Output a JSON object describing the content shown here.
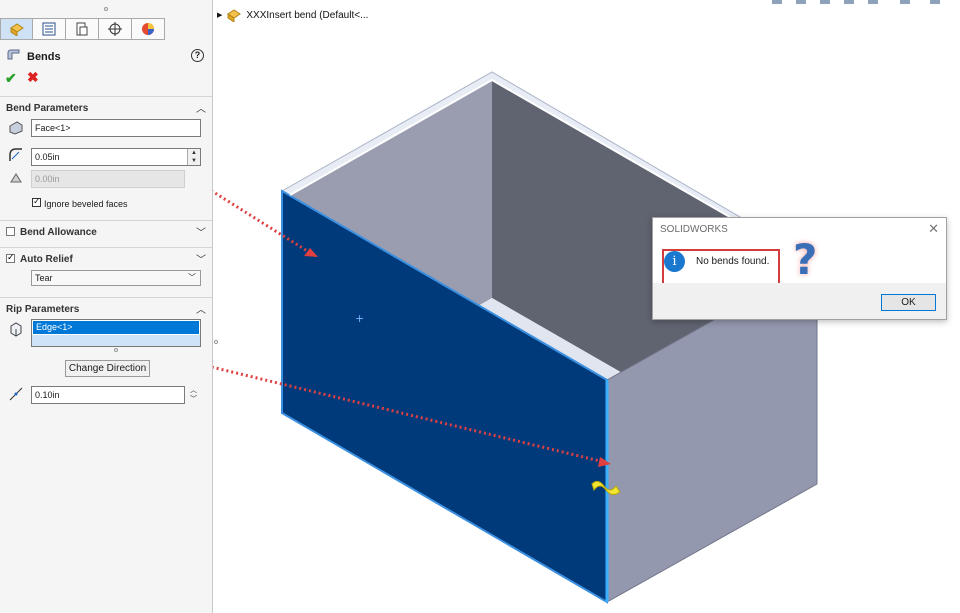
{
  "tree": {
    "item": "XXXInsert bend  (Default<..."
  },
  "panel": {
    "title": "Bends",
    "bend_parameters": {
      "label": "Bend Parameters",
      "fixed_face": "Face<1>",
      "bend_radius": "0.05in",
      "thickness": "0.00in",
      "ignore_beveled_label": "Ignore beveled faces"
    },
    "bend_allowance": {
      "label": "Bend Allowance"
    },
    "auto_relief": {
      "label": "Auto Relief",
      "type": "Tear"
    },
    "rip_parameters": {
      "label": "Rip Parameters",
      "edge": "Edge<1>",
      "change_direction": "Change Direction",
      "rip_gap": "0.10in"
    }
  },
  "dialog": {
    "title": "SOLIDWORKS",
    "message": "No bends found.",
    "ok": "OK"
  },
  "colors": {
    "selected_face": "#003a7a",
    "box_side": "#9498ae",
    "box_top": "#e8ecf4",
    "inner_back": "#606470",
    "highlight": "#d23c3c"
  }
}
